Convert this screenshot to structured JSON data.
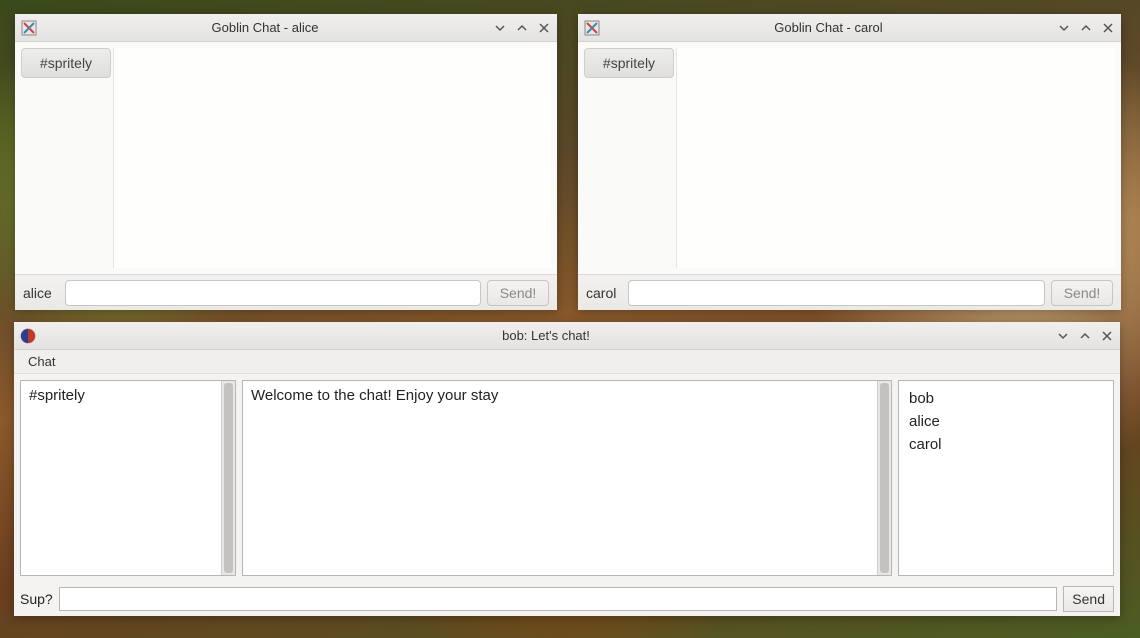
{
  "windows": {
    "alice": {
      "title": "Goblin Chat - alice",
      "channel": "#spritely",
      "username": "alice",
      "input_value": "",
      "send_label": "Send!"
    },
    "carol": {
      "title": "Goblin Chat - carol",
      "channel": "#spritely",
      "username": "carol",
      "input_value": "",
      "send_label": "Send!"
    },
    "bob": {
      "title": "bob: Let's chat!",
      "menu": {
        "chat": "Chat"
      },
      "channels": [
        "#spritely"
      ],
      "welcome": "Welcome to the chat!  Enjoy your stay",
      "users": [
        "bob",
        "alice",
        "carol"
      ],
      "prompt": "Sup?",
      "input_value": "",
      "send_label": "Send"
    }
  },
  "icons": {
    "minimize": "minimize-icon",
    "maximize": "maximize-icon",
    "close": "close-icon"
  }
}
